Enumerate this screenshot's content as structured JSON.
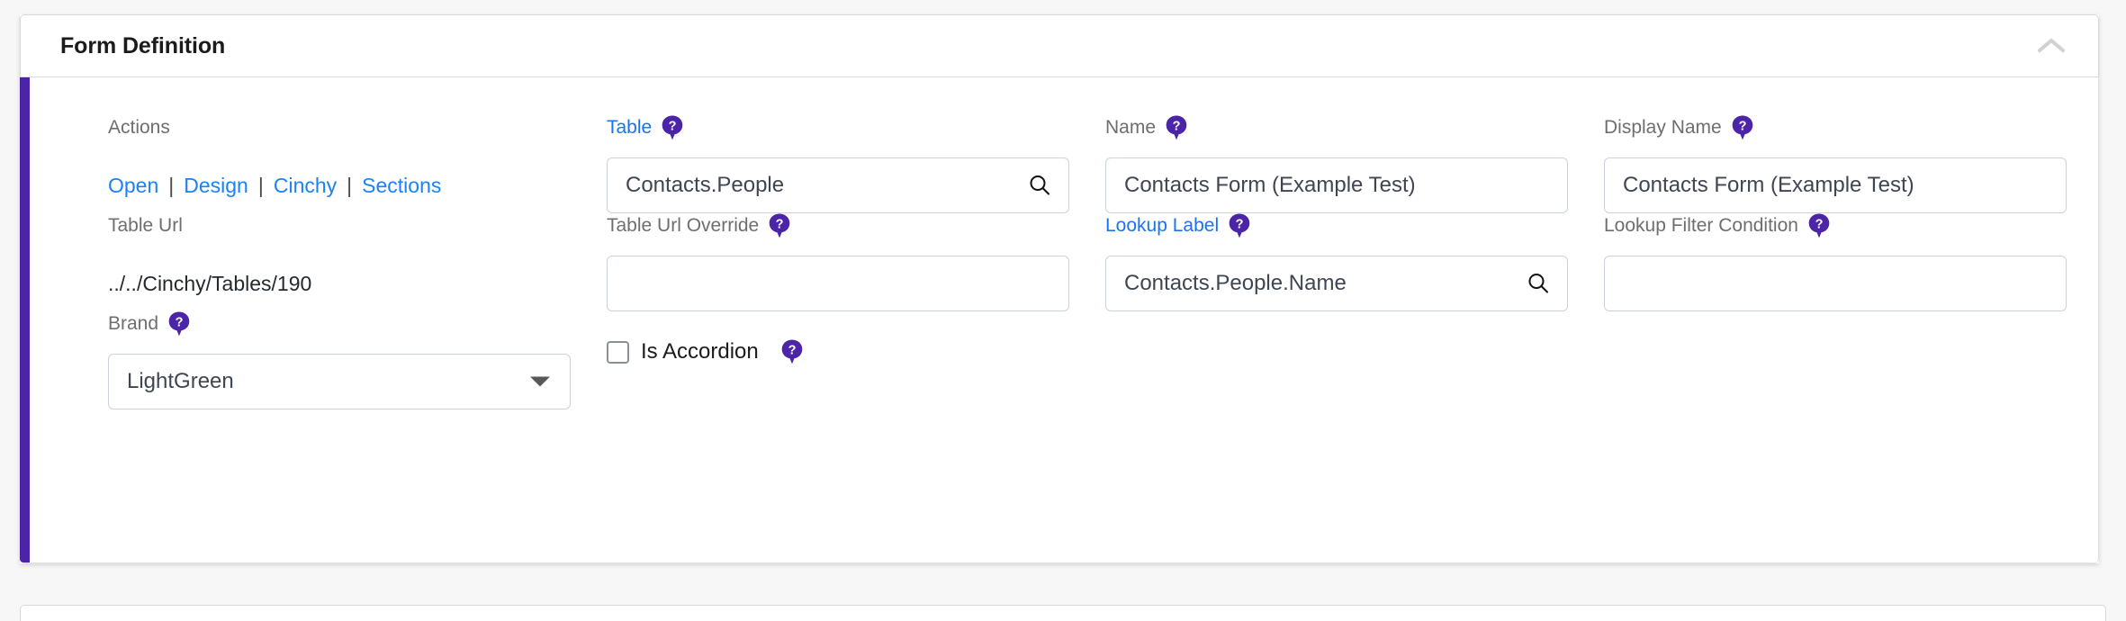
{
  "card": {
    "title": "Form Definition",
    "collapse_icon": "chevron-up-icon",
    "accent_color": "#4b24a8"
  },
  "fields": {
    "actions": {
      "label": "Actions",
      "links": [
        "Open",
        "Design",
        "Cinchy",
        "Sections"
      ],
      "separator": "|"
    },
    "table": {
      "label": "Table",
      "label_is_link": true,
      "help_icon": "help-icon",
      "value": "Contacts.People",
      "search_icon": "search-icon"
    },
    "name": {
      "label": "Name",
      "help_icon": "help-icon",
      "value": "Contacts Form (Example Test)"
    },
    "display_name": {
      "label": "Display Name",
      "help_icon": "help-icon",
      "value": "Contacts Form (Example Test)"
    },
    "table_url": {
      "label": "Table Url",
      "value": "../../Cinchy/Tables/190"
    },
    "table_url_override": {
      "label": "Table Url Override",
      "help_icon": "help-icon",
      "value": ""
    },
    "lookup_label": {
      "label": "Lookup Label",
      "label_is_link": true,
      "help_icon": "help-icon",
      "value": "Contacts.People.Name",
      "search_icon": "search-icon"
    },
    "lookup_filter_condition": {
      "label": "Lookup Filter Condition",
      "help_icon": "help-icon",
      "value": ""
    },
    "brand": {
      "label": "Brand",
      "help_icon": "help-icon",
      "value": "LightGreen",
      "dropdown_icon": "chevron-down-icon"
    },
    "is_accordion": {
      "label": "Is Accordion",
      "checked": false,
      "help_icon": "help-icon"
    }
  },
  "colors": {
    "accent_purple": "#4b24a8",
    "link_blue": "#1a82f7",
    "label_gray": "#6e6e6e",
    "value_gray": "#3f4652",
    "help_purple": "#4b24a8"
  }
}
